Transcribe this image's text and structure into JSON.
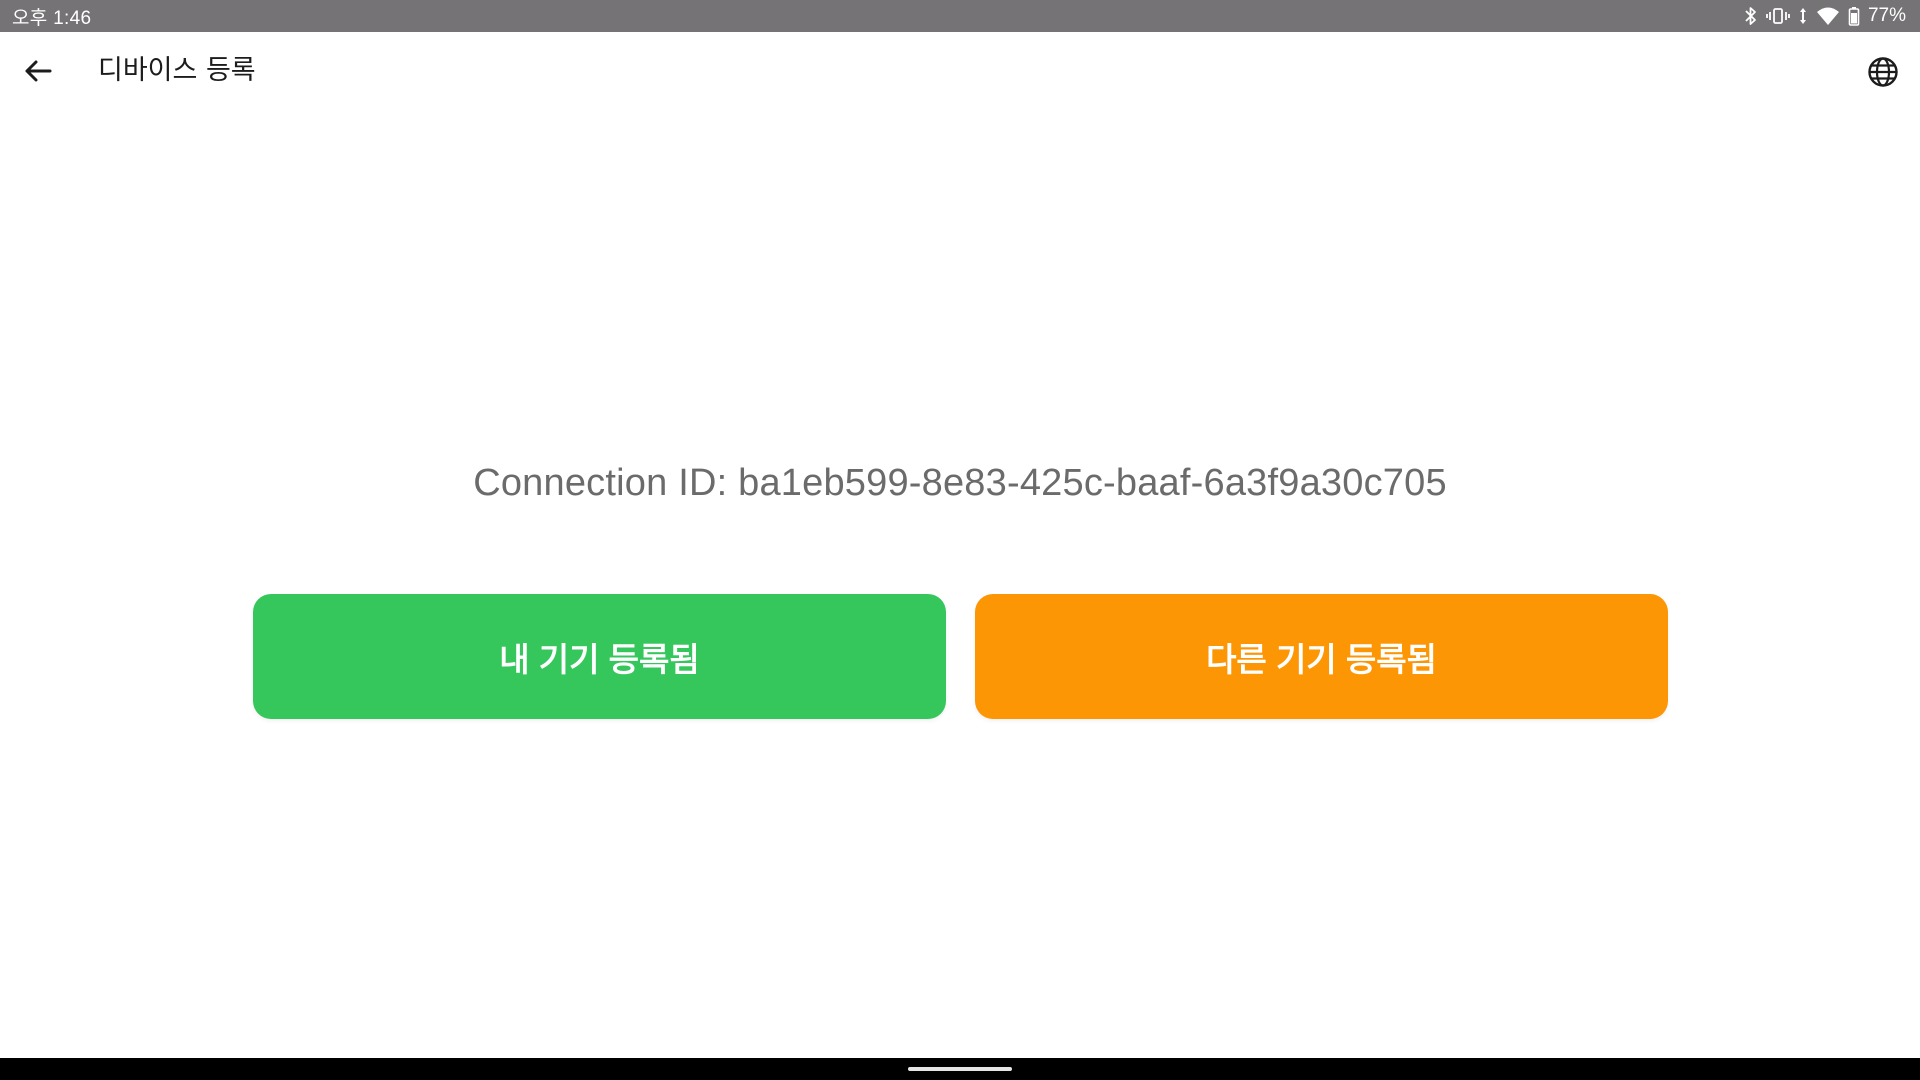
{
  "status_bar": {
    "time": "오후 1:46",
    "battery_percent": "77%",
    "icons": [
      "bluetooth-icon",
      "vibrate-icon",
      "data-arrows-icon",
      "wifi-icon",
      "battery-icon"
    ]
  },
  "app_bar": {
    "back_icon": "arrow-left-icon",
    "title": "디바이스 등록",
    "language_icon": "globe-icon"
  },
  "content": {
    "connection_id": "Connection ID: ba1eb599-8e83-425c-baaf-6a3f9a30c705"
  },
  "buttons": {
    "mine_label": "내 기기 등록됨",
    "mine_color": "#36c75c",
    "other_label": "다른 기기 등록됨",
    "other_color": "#fc9605"
  },
  "colors": {
    "status_bar_bg": "#757375",
    "text_primary": "#1c1c1c",
    "text_secondary": "#6b6b6b"
  }
}
